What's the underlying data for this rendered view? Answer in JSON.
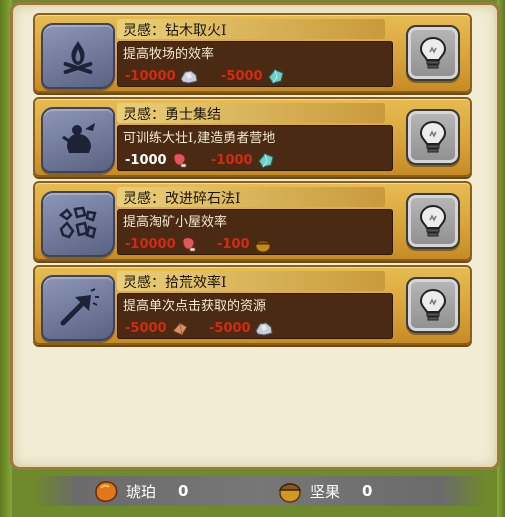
{
  "cards": [
    {
      "title": "灵感：钻木取火I",
      "desc": "提高牧场的效率",
      "icon": "campfire-icon",
      "costs": [
        {
          "value": "-10000",
          "color": "#d42a12",
          "resource": "stone-icon"
        },
        {
          "value": "-5000",
          "color": "#d42a12",
          "resource": "crystal-icon"
        }
      ]
    },
    {
      "title": "灵感：勇士集结",
      "desc": "可训练大壮I,建造勇者营地",
      "icon": "warrior-icon",
      "costs": [
        {
          "value": "-1000",
          "color": "#ffffff",
          "resource": "meat-icon"
        },
        {
          "value": "-1000",
          "color": "#d42a12",
          "resource": "crystal-icon"
        }
      ]
    },
    {
      "title": "灵感：改进碎石法I",
      "desc": "提高淘矿小屋效率",
      "icon": "broken-rocks-icon",
      "costs": [
        {
          "value": "-10000",
          "color": "#d42a12",
          "resource": "meat-icon"
        },
        {
          "value": "-100",
          "color": "#d42a12",
          "resource": "nut-icon"
        }
      ]
    },
    {
      "title": "灵感：拾荒效率I",
      "desc": "提高单次点击获取的资源",
      "icon": "upgrade-arrow-icon",
      "costs": [
        {
          "value": "-5000",
          "color": "#d42a12",
          "resource": "wood-icon"
        },
        {
          "value": "-5000",
          "color": "#d42a12",
          "resource": "stone-icon"
        }
      ]
    }
  ],
  "footer": {
    "amber_label": "琥珀",
    "amber_value": "0",
    "nut_label": "坚果",
    "nut_value": "0"
  },
  "colors": {
    "card_gold": "#d9a43a",
    "desc_bg": "#4a2a12",
    "cost_red": "#d42a12"
  }
}
